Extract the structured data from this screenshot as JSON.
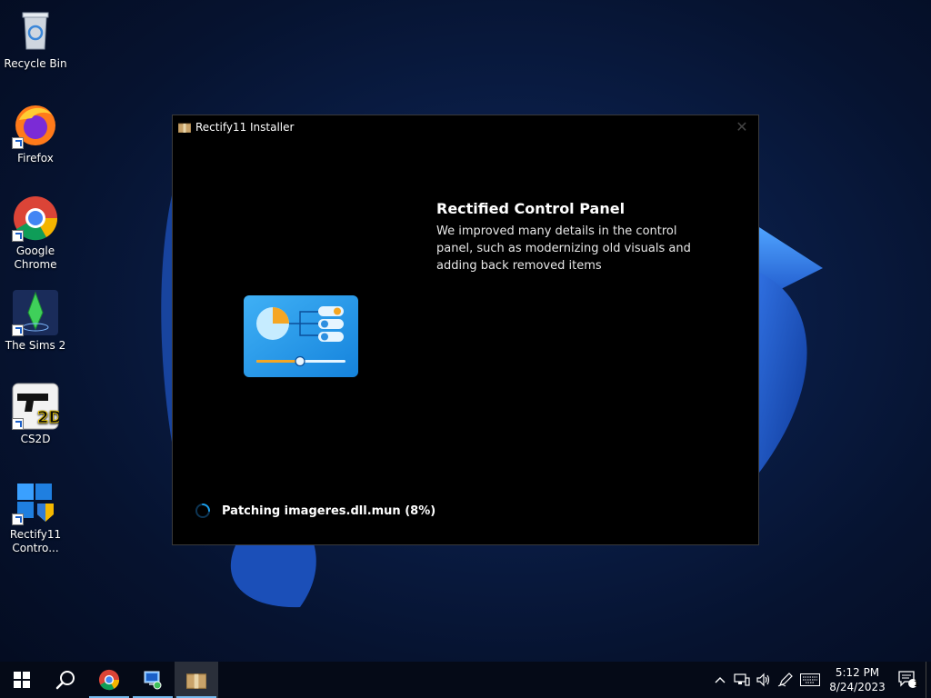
{
  "desktop": {
    "icons": [
      {
        "label": "Recycle Bin",
        "icon": "recycle-bin-icon"
      },
      {
        "label": "Firefox",
        "icon": "firefox-icon"
      },
      {
        "label": "Google Chrome",
        "icon": "chrome-icon"
      },
      {
        "label": "The Sims 2",
        "icon": "sims-icon"
      },
      {
        "label": "CS2D",
        "icon": "cs2d-icon"
      },
      {
        "label": "Rectify11 Contro...",
        "icon": "rectify11-icon"
      }
    ]
  },
  "installer": {
    "title": "Rectify11 Installer",
    "close_glyph": "✕",
    "feature_title": "Rectified Control Panel",
    "feature_description": "We improved many details in the control panel, such as modernizing old visuals and adding back removed items",
    "status_text": "Patching imageres.dll.mun (8%)",
    "accent_color": "#1a9be6"
  },
  "taskbar": {
    "apps": [
      {
        "name": "start",
        "icon": "windows-start-icon"
      },
      {
        "name": "search",
        "icon": "search-icon"
      },
      {
        "name": "chrome",
        "icon": "chrome-icon"
      },
      {
        "name": "control-panel",
        "icon": "control-panel-icon"
      },
      {
        "name": "installer",
        "icon": "package-icon"
      }
    ],
    "tray": {
      "icons": [
        "chevron-up-icon",
        "network-icon",
        "volume-icon",
        "pen-icon",
        "keyboard-icon"
      ],
      "time": "5:12 PM",
      "date": "8/24/2023",
      "notification_count": "1"
    }
  }
}
